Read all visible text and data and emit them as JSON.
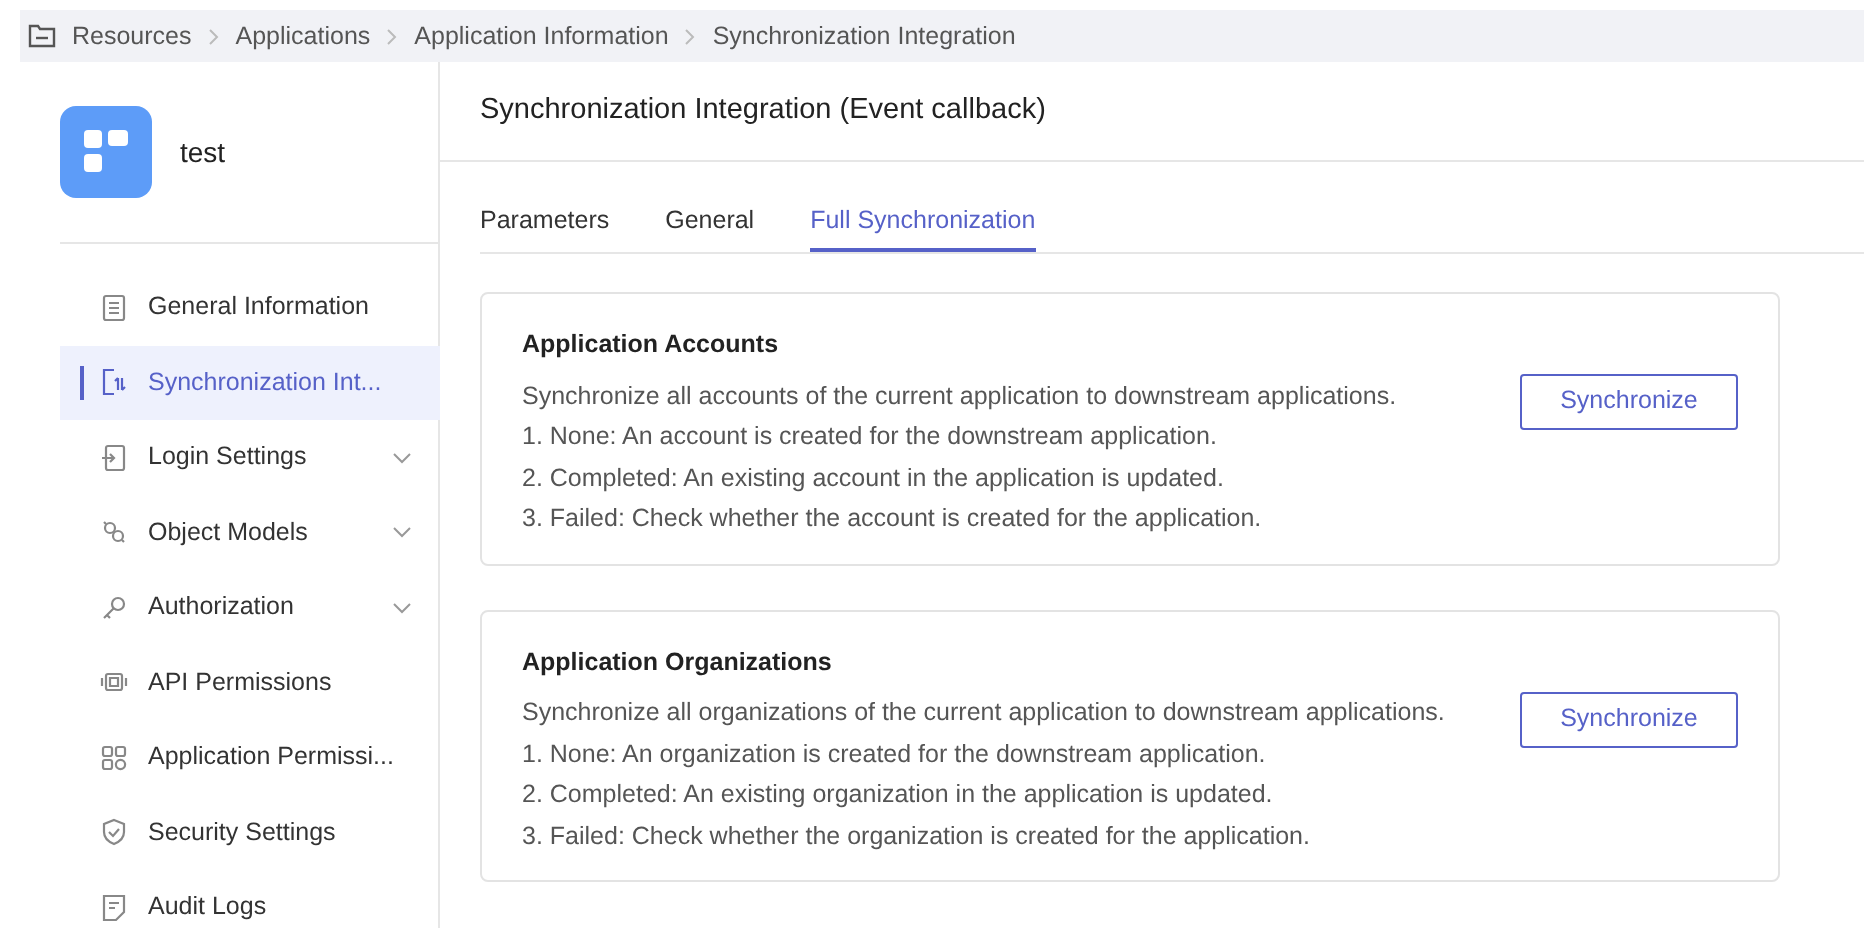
{
  "breadcrumb": [
    "Resources",
    "Applications",
    "Application Information",
    "Synchronization Integration"
  ],
  "app": {
    "name": "test"
  },
  "sidebar": {
    "items": [
      {
        "label": "General Information",
        "kind": "document",
        "expandable": false,
        "selected": false
      },
      {
        "label": "Synchronization Int...",
        "kind": "sync",
        "expandable": false,
        "selected": true
      },
      {
        "label": "Login Settings",
        "kind": "login",
        "expandable": true,
        "selected": false
      },
      {
        "label": "Object Models",
        "kind": "model",
        "expandable": true,
        "selected": false
      },
      {
        "label": "Authorization",
        "kind": "key",
        "expandable": true,
        "selected": false
      },
      {
        "label": "API Permissions",
        "kind": "chip",
        "expandable": false,
        "selected": false
      },
      {
        "label": "Application Permissi...",
        "kind": "grid",
        "expandable": false,
        "selected": false
      },
      {
        "label": "Security Settings",
        "kind": "shield",
        "expandable": false,
        "selected": false
      },
      {
        "label": "Audit Logs",
        "kind": "log",
        "expandable": false,
        "selected": false
      }
    ]
  },
  "page_title": "Synchronization Integration (Event callback)",
  "tabs": [
    {
      "label": "Parameters",
      "selected": false
    },
    {
      "label": "General",
      "selected": false
    },
    {
      "label": "Full Synchronization",
      "selected": true
    }
  ],
  "sections": [
    {
      "title": "Application Accounts",
      "lines": [
        "Synchronize all accounts of the current application to downstream applications.",
        "1. None: An account is created for the downstream application.",
        "2. Completed: An existing account in the application is updated.",
        "3. Failed: Check whether the account is created for the application."
      ],
      "button": "Synchronize"
    },
    {
      "title": "Application Organizations",
      "lines": [
        "Synchronize all organizations of the current application to downstream applications.",
        "1. None: An organization is created for the downstream application.",
        "2. Completed: An existing organization in the application is updated.",
        "3. Failed: Check whether the organization is created for the application."
      ],
      "button": "Synchronize"
    }
  ]
}
